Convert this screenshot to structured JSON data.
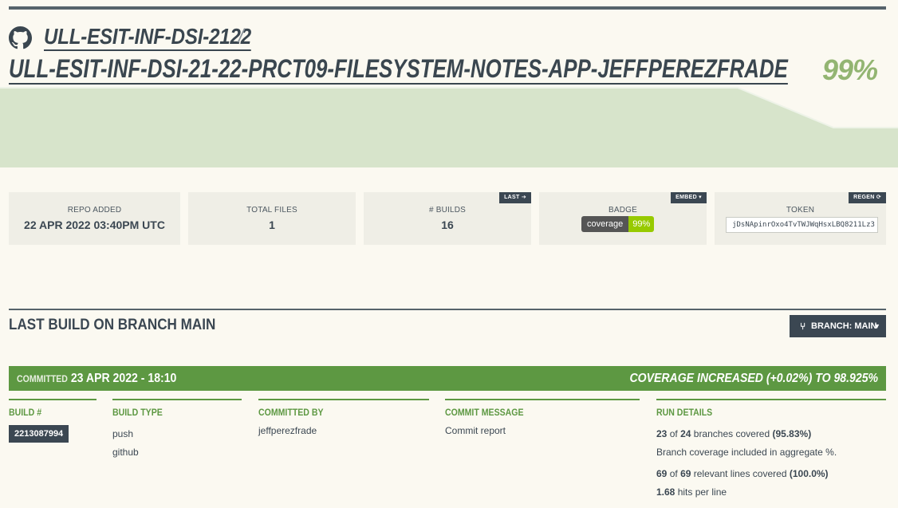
{
  "repo": {
    "owner": "ULL-ESIT-INF-DSI-2122",
    "separator": "/",
    "name": "ULL-ESIT-INF-DSI-21-22-PRCT09-FILESYSTEM-NOTES-APP-JEFFPEREZFRADE",
    "coverage": "99%"
  },
  "stats": {
    "repo_added": {
      "label": "REPO ADDED",
      "value": "22 APR 2022 03:40PM UTC"
    },
    "total_files": {
      "label": "TOTAL FILES",
      "value": "1"
    },
    "builds": {
      "label": "# BUILDS",
      "value": "16",
      "tag": "LAST"
    },
    "badge": {
      "label": "BADGE",
      "left": "coverage",
      "right": "99%",
      "tag": "EMBED ▾"
    },
    "token": {
      "label": "TOKEN",
      "value": "jDsNApinrOxo4TvTWJWqHsxLBQ8211Lz3",
      "tag": "REGEN"
    }
  },
  "section": {
    "title": "LAST BUILD ON BRANCH MAIN",
    "branch_button": "BRANCH: MAIN"
  },
  "commit": {
    "committed_label": "COMMITTED",
    "committed_date": "23 APR 2022 - 18:10",
    "coverage_change": "COVERAGE INCREASED (+0.02%) TO 98.925%"
  },
  "details": {
    "build": {
      "head": "BUILD #",
      "value": "2213087994"
    },
    "build_type": {
      "head": "BUILD TYPE",
      "lines": [
        "push",
        "github"
      ]
    },
    "committed_by": {
      "head": "COMMITTED BY",
      "value": "jeffperezfrade"
    },
    "commit_message": {
      "head": "COMMIT MESSAGE",
      "value": "Commit report"
    },
    "run_details": {
      "head": "RUN DETAILS",
      "branches_covered": "23",
      "branches_of": "of",
      "branches_total": "24",
      "branches_text": "branches covered",
      "branches_pct": "(95.83%)",
      "aggregate_note": "Branch coverage included in aggregate %.",
      "lines_covered": "69",
      "lines_of": "of",
      "lines_total": "69",
      "lines_text": "relevant lines covered",
      "lines_pct": "(100.0%)",
      "hits": "1.68",
      "hits_text": "hits per line"
    }
  },
  "colors": {
    "accent_green": "#5d9842",
    "chart_fill": "#d7e4cb",
    "dark": "#3b4752"
  }
}
